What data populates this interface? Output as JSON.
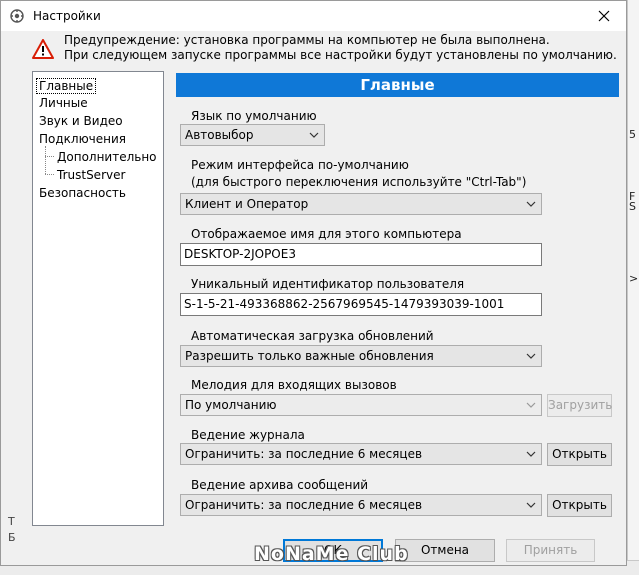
{
  "window": {
    "title": "Настройки"
  },
  "warning": {
    "line1": "Предупреждение: установка программы на компьютер не была выполнена.",
    "line2": "При следующем запуске программы все настройки будут установлены по умолчанию."
  },
  "tree": {
    "items": [
      {
        "label": "Главные",
        "selected": true
      },
      {
        "label": "Личные"
      },
      {
        "label": "Звук и Видео"
      },
      {
        "label": "Подключения"
      },
      {
        "label": "Дополнительно"
      },
      {
        "label": "TrustServer"
      },
      {
        "label": "Безопасность"
      }
    ]
  },
  "section": {
    "title": "Главные"
  },
  "fields": {
    "language": {
      "label": "Язык по умолчанию",
      "value": "Автовыбор"
    },
    "mode": {
      "label1": "Режим интерфейса по-умолчанию",
      "label2": "(для быстрого переключения используйте \"Ctrl-Tab\")",
      "value": "Клиент и Оператор"
    },
    "display_name": {
      "label": "Отображаемое имя для этого компьютера",
      "value": "DESKTOP-2JOPOE3"
    },
    "user_id": {
      "label": "Уникальный идентификатор пользователя",
      "value": "S-1-5-21-493368862-2567969545-1479393039-1001"
    },
    "updates": {
      "label": "Автоматическая загрузка обновлений",
      "value": "Разрешить только важные обновления"
    },
    "ringtone": {
      "label": "Мелодия для входящих вызовов",
      "value": "По умолчанию",
      "button": "Загрузить"
    },
    "log": {
      "label": "Ведение журнала",
      "value": "Ограничить: за последние 6 месяцев",
      "button": "Открыть"
    },
    "archive": {
      "label": "Ведение архива сообщений",
      "value": "Ограничить: за последние 6 месяцев",
      "button": "Открыть"
    }
  },
  "footer": {
    "ok": "ОК",
    "cancel": "Отмена",
    "apply": "Принять"
  },
  "watermark": "NoNaMe Club",
  "background": {
    "left_marks": [
      "Т",
      "Б"
    ],
    "right_marks": [
      "5",
      "F",
      "S",
      ">"
    ]
  },
  "colors": {
    "accent": "#0f78d7",
    "warning": "#d81e06"
  }
}
